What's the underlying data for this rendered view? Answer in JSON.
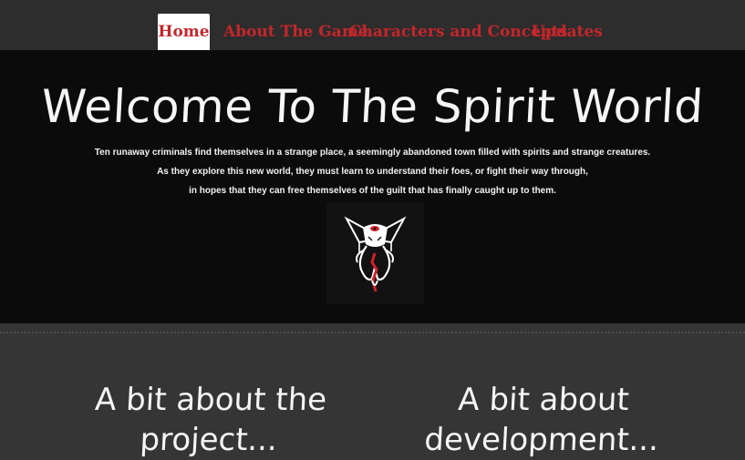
{
  "nav": {
    "items": [
      {
        "label": "Home",
        "active": true
      },
      {
        "label": "About The Game",
        "active": false
      },
      {
        "label": "Characters and Concepts",
        "active": false
      },
      {
        "label": "Updates",
        "active": false
      }
    ]
  },
  "hero": {
    "title": "Welcome To The Spirit World",
    "lines": [
      "Ten runaway criminals find themselves in a strange place, a seemingly abandoned town filled with spirits and strange creatures.",
      "As they explore this new world, they must learn to understand their foes, or fight their way through,",
      "in hopes that they can free themselves of the guilt that has finally caught up to them."
    ],
    "logo_icon": "spirit-emblem-icon"
  },
  "sections": [
    {
      "heading_line1": "A bit about the",
      "heading_line2": "project..."
    },
    {
      "heading_line1": "A bit about",
      "heading_line2": "development..."
    }
  ],
  "colors": {
    "accent": "#c4262b",
    "hero_bg": "#0b0b0b",
    "page_bg": "#353535",
    "nav_bg": "#2d2d2d"
  }
}
